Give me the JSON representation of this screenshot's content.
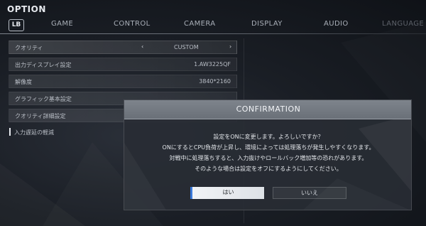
{
  "screen": {
    "title": "OPTION",
    "lb_label": "LB"
  },
  "tabs": [
    {
      "label": "GAME",
      "state": "normal"
    },
    {
      "label": "CONTROL",
      "state": "normal"
    },
    {
      "label": "CAMERA",
      "state": "normal"
    },
    {
      "label": "DISPLAY",
      "state": "normal"
    },
    {
      "label": "AUDIO",
      "state": "normal"
    },
    {
      "label": "LANGUAGE",
      "state": "dim"
    }
  ],
  "settings": [
    {
      "label": "クオリティ",
      "value": "CUSTOM"
    },
    {
      "label": "出力ディスプレイ設定",
      "value": "1.AW3225QF"
    },
    {
      "label": "解像度",
      "value": "3840*2160"
    },
    {
      "label": "グラフィック基本設定",
      "value": ""
    },
    {
      "label": "クオリティ詳細設定",
      "value": ""
    },
    {
      "label": "入力遅延の軽減",
      "value": ""
    }
  ],
  "arrows": {
    "left": "‹",
    "right": "›"
  },
  "dialog": {
    "title": "CONFIRMATION",
    "lines": [
      "設定をONに変更します。よろしいですか？",
      "ONにするとCPU負荷が上昇し、環境によっては処理落ちが発生しやすくなります。",
      "対戦中に処理落ちすると、入力抜けやロールバック増加等の恐れがあります。",
      "そのような場合は設定をオフにするようにしてください。"
    ],
    "yes_label": "はい",
    "no_label": "いいえ"
  },
  "colors": {
    "accent": "#3a78d8",
    "header": "#7e848c"
  }
}
